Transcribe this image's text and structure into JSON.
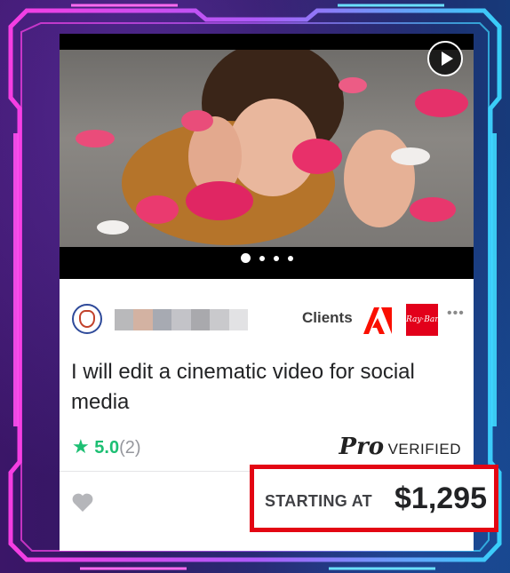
{
  "media": {
    "play_icon": "play-icon",
    "dots": [
      true,
      false,
      false,
      false
    ]
  },
  "seller": {
    "logo_icon": "seller-logo-icon",
    "name_blur_colors": [
      "#b9b9bb",
      "#d3b2a2",
      "#a7aab2",
      "#c3c3c8",
      "#a9a9ad",
      "#c9c9cc",
      "#e2e2e4"
    ]
  },
  "clients": {
    "label": "Clients",
    "logos": [
      "adobe-logo",
      "ray-ban-logo"
    ],
    "more_icon": "more-dots-icon"
  },
  "gig": {
    "title": "I will edit a cinematic video for social media"
  },
  "rating": {
    "value": "5.0",
    "count": "(2)"
  },
  "pro": {
    "pro_text": "Pro",
    "verified_text": "VERIFIED"
  },
  "price": {
    "label": "STARTING AT",
    "value": "$1,295"
  },
  "colors": {
    "accent_green": "#1dbf73",
    "highlight_red": "#e30613",
    "adobe_red": "#fa0f00",
    "rayban_red": "#e2001a"
  }
}
